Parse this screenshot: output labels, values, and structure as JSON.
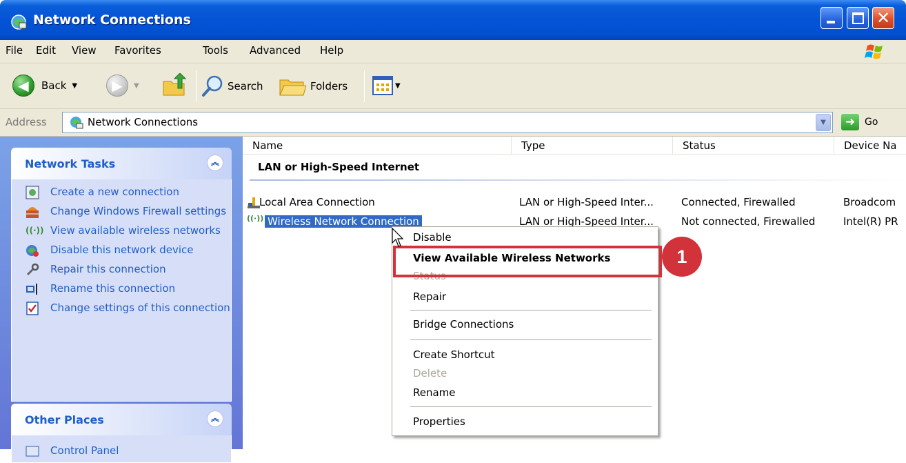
{
  "window": {
    "title": "Network Connections"
  },
  "menubar": {
    "items": [
      "File",
      "Edit",
      "View",
      "Favorites",
      "Tools",
      "Advanced",
      "Help"
    ]
  },
  "toolbar": {
    "back_label": "Back",
    "search_label": "Search",
    "folders_label": "Folders"
  },
  "address": {
    "label": "Address",
    "value": "Network Connections",
    "go_label": "Go"
  },
  "network_tasks": {
    "title": "Network Tasks",
    "items": [
      "Create a new connection",
      "Change Windows Firewall settings",
      "View available wireless networks",
      "Disable this network device",
      "Repair this connection",
      "Rename this connection",
      "Change settings of this connection"
    ]
  },
  "other_places": {
    "title": "Other Places",
    "first_item": "Control Panel"
  },
  "columns": [
    "Name",
    "Type",
    "Status",
    "Device Na"
  ],
  "group": {
    "title": "LAN or High-Speed Internet"
  },
  "rows": [
    {
      "name": "Local Area Connection",
      "type": "LAN or High-Speed Inter...",
      "status": "Connected, Firewalled",
      "device": "Broadcom"
    },
    {
      "name": "Wireless Network Connection",
      "type": "LAN or High-Speed Inter...",
      "status": "Not connected, Firewalled",
      "device": "Intel(R) PR"
    }
  ],
  "context_menu": {
    "disable": "Disable",
    "view_wireless": "View Available Wireless Networks",
    "status": "Status",
    "repair": "Repair",
    "bridge": "Bridge Connections",
    "create_shortcut": "Create Shortcut",
    "delete": "Delete",
    "rename": "Rename",
    "properties": "Properties"
  },
  "callout": {
    "number": "1"
  },
  "colors": {
    "highlight": "#d2323a",
    "selection": "#316ac5",
    "link": "#215dc6",
    "title_bar": "#0453d6"
  }
}
